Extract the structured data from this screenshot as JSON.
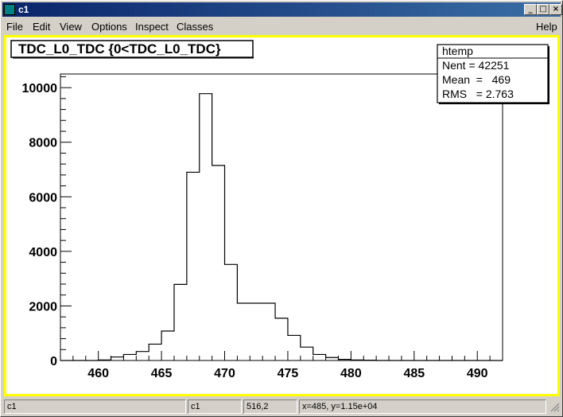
{
  "window": {
    "title": "c1",
    "controls": {
      "minimize": "_",
      "maximize": "□",
      "close": "×"
    }
  },
  "menu": {
    "left": [
      {
        "label": "File"
      },
      {
        "label": "Edit"
      },
      {
        "label": "View"
      },
      {
        "label": "Options"
      },
      {
        "label": "Inspect"
      },
      {
        "label": "Classes"
      }
    ],
    "right": {
      "label": "Help"
    }
  },
  "plot": {
    "title": "TDC_L0_TDC {0<TDC_L0_TDC}",
    "stats": {
      "name": "htemp",
      "entries_label": "Nent = 42251",
      "mean_label": "Mean  =   469",
      "rms_label": "RMS   = 2.763"
    }
  },
  "chart_data": {
    "type": "bar",
    "histogram": true,
    "bin_edges": [
      457,
      458,
      459,
      460,
      461,
      462,
      463,
      464,
      465,
      466,
      467,
      468,
      469,
      470,
      471,
      472,
      473,
      474,
      475,
      476,
      477,
      478,
      479,
      480,
      481,
      482,
      483,
      484,
      485,
      486,
      487,
      488,
      489,
      490,
      491,
      492
    ],
    "values": [
      0,
      0,
      0,
      20,
      130,
      220,
      330,
      600,
      1080,
      2790,
      6900,
      9780,
      7150,
      3520,
      2100,
      2100,
      2100,
      1550,
      920,
      490,
      220,
      110,
      40,
      20,
      10,
      0,
      0,
      0,
      0,
      0,
      0,
      0,
      0,
      0,
      0
    ],
    "xlim": [
      457,
      492
    ],
    "ylim": [
      0,
      10500
    ],
    "xticks": [
      460,
      465,
      470,
      475,
      480,
      485,
      490
    ],
    "yticks": [
      0,
      2000,
      4000,
      6000,
      8000,
      10000
    ],
    "xlabel": "",
    "ylabel": "",
    "grid": false,
    "colors": {
      "frame_border": "#ffff00",
      "line": "#000000",
      "canvas": "#ffffff"
    }
  },
  "status": {
    "cells": [
      "c1",
      "c1",
      "516,2",
      "x=485, y=1.15e+04"
    ]
  }
}
